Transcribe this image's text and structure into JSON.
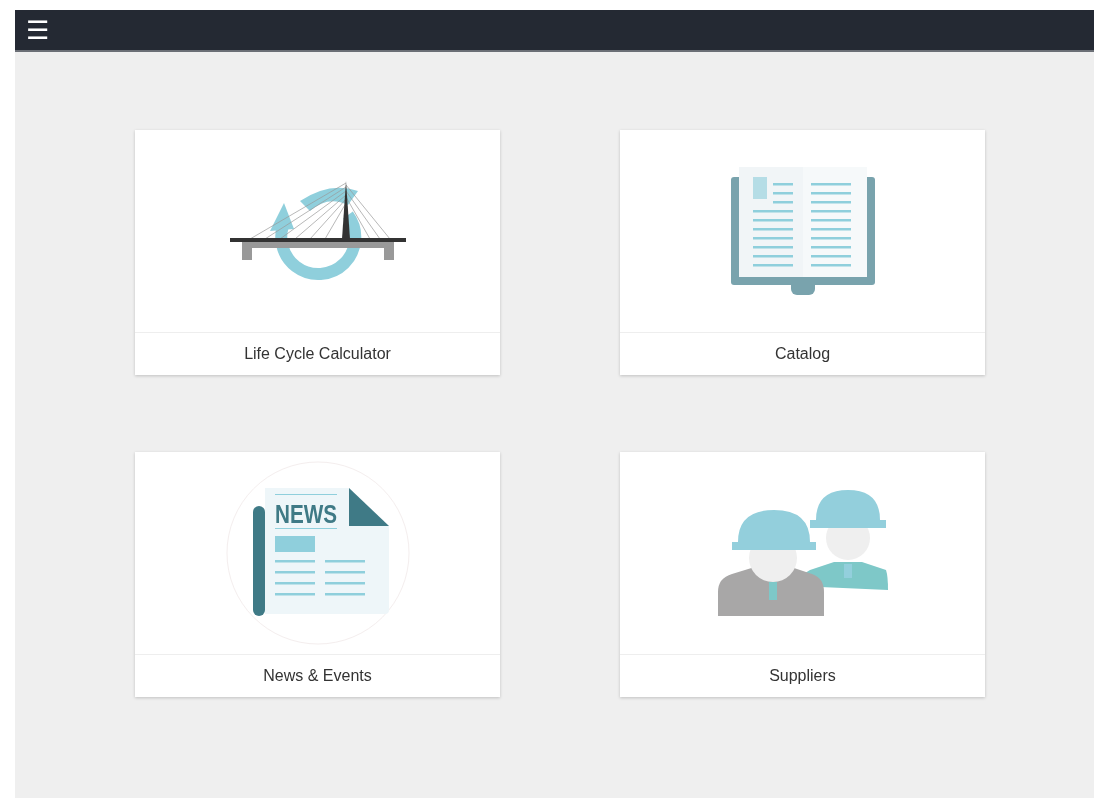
{
  "top_bar": {
    "menu_icon": "☰"
  },
  "tiles": [
    {
      "kind": "bridge",
      "label": "Life Cycle Calculator"
    },
    {
      "kind": "catalog",
      "label": "Catalog"
    },
    {
      "kind": "news",
      "label": "News & Events",
      "icon_text": "NEWS"
    },
    {
      "kind": "suppliers",
      "label": "Suppliers"
    }
  ]
}
